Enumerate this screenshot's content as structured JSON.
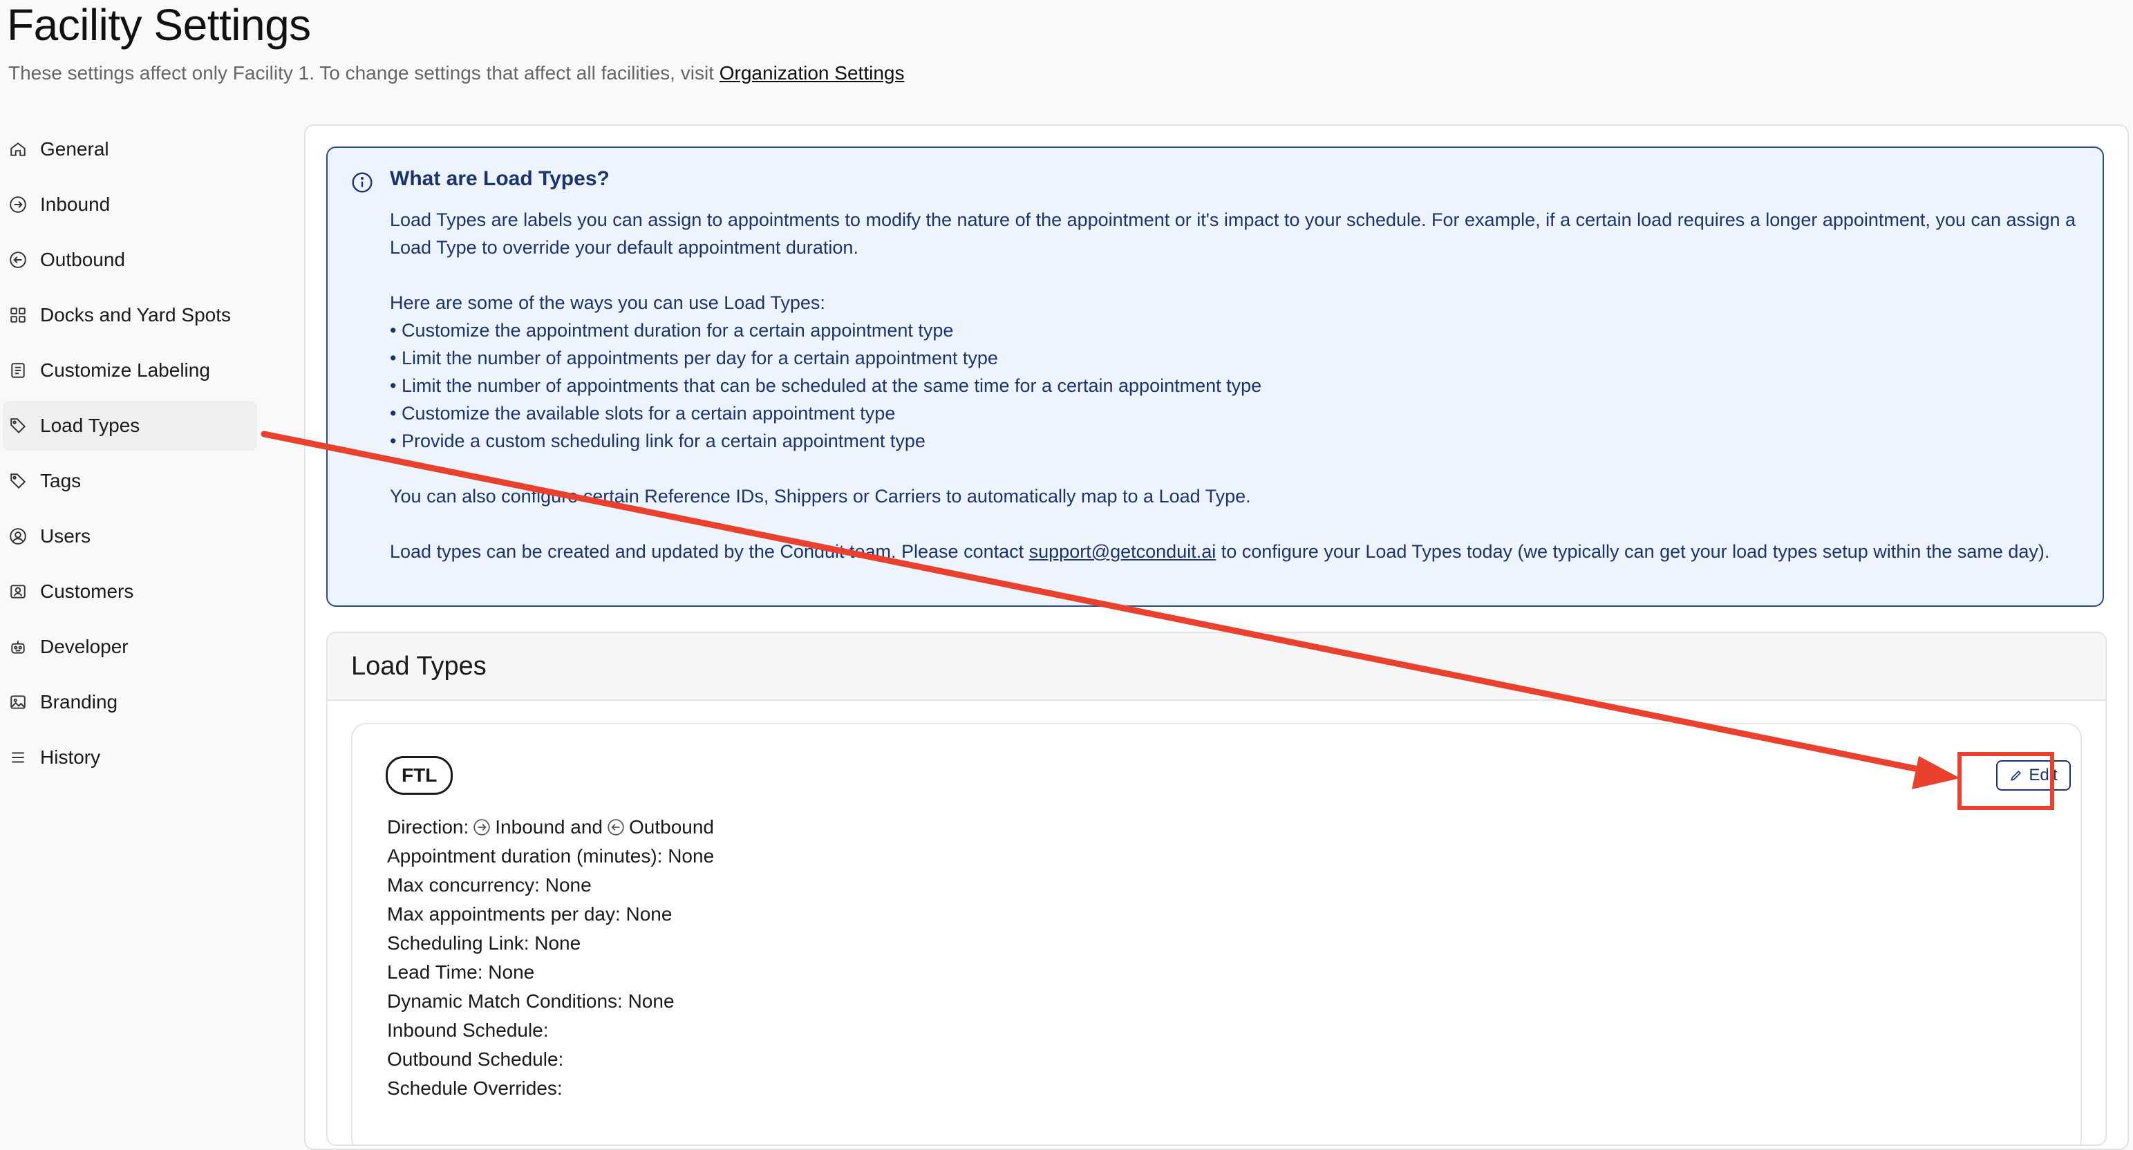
{
  "page": {
    "title": "Facility Settings",
    "subtitle": "These settings affect only Facility 1. To change settings that affect all facilities, visit ",
    "subtitle_link": "Organization Settings"
  },
  "sidebar": {
    "items": [
      {
        "label": "General",
        "icon": "home-icon"
      },
      {
        "label": "Inbound",
        "icon": "arrow-right-circle-icon"
      },
      {
        "label": "Outbound",
        "icon": "arrow-left-circle-icon"
      },
      {
        "label": "Docks and Yard Spots",
        "icon": "grid-icon"
      },
      {
        "label": "Customize Labeling",
        "icon": "label-list-icon"
      },
      {
        "label": "Load Types",
        "icon": "tag-icon",
        "active": true
      },
      {
        "label": "Tags",
        "icon": "tag-icon"
      },
      {
        "label": "Users",
        "icon": "user-circle-icon"
      },
      {
        "label": "Customers",
        "icon": "contact-card-icon"
      },
      {
        "label": "Developer",
        "icon": "robot-icon"
      },
      {
        "label": "Branding",
        "icon": "image-icon"
      },
      {
        "label": "History",
        "icon": "list-icon"
      }
    ]
  },
  "info": {
    "title": "What are Load Types?",
    "p1": "Load Types are labels you can assign to appointments to modify the nature of the appointment or it's impact to your schedule. For example, if a certain load requires a longer appointment, you can assign a Load Type to override your default appointment duration.",
    "list_intro": "Here are some of the ways you can use Load Types:",
    "bullets": [
      "• Customize the appointment duration for a certain appointment type",
      "• Limit the number of appointments per day for a certain appointment type",
      "• Limit the number of appointments that can be scheduled at the same time for a certain appointment type",
      "• Customize the available slots for a certain appointment type",
      "• Provide a custom scheduling link for a certain appointment type"
    ],
    "p2": "You can also configure certain Reference IDs, Shippers or Carriers to automatically map to a Load Type.",
    "p3_before": "Load types can be created and updated by the Conduit team. Please contact ",
    "p3_link": "support@getconduit.ai",
    "p3_after": " to configure your Load Types today (we typically can get your load types setup within the same day)."
  },
  "load_types": {
    "header": "Load Types",
    "card": {
      "badge": "FTL",
      "edit_label": "Edit",
      "direction_label": "Direction:",
      "direction_inbound": "Inbound and",
      "direction_outbound": "Outbound",
      "details": [
        "Appointment duration (minutes): None",
        "Max concurrency: None",
        "Max appointments per day: None",
        "Scheduling Link: None",
        "Lead Time: None",
        "Dynamic Match Conditions: None",
        "Inbound Schedule:",
        "Outbound Schedule:",
        "Schedule Overrides:"
      ]
    }
  },
  "annotation": {
    "color": "#e8412e"
  }
}
